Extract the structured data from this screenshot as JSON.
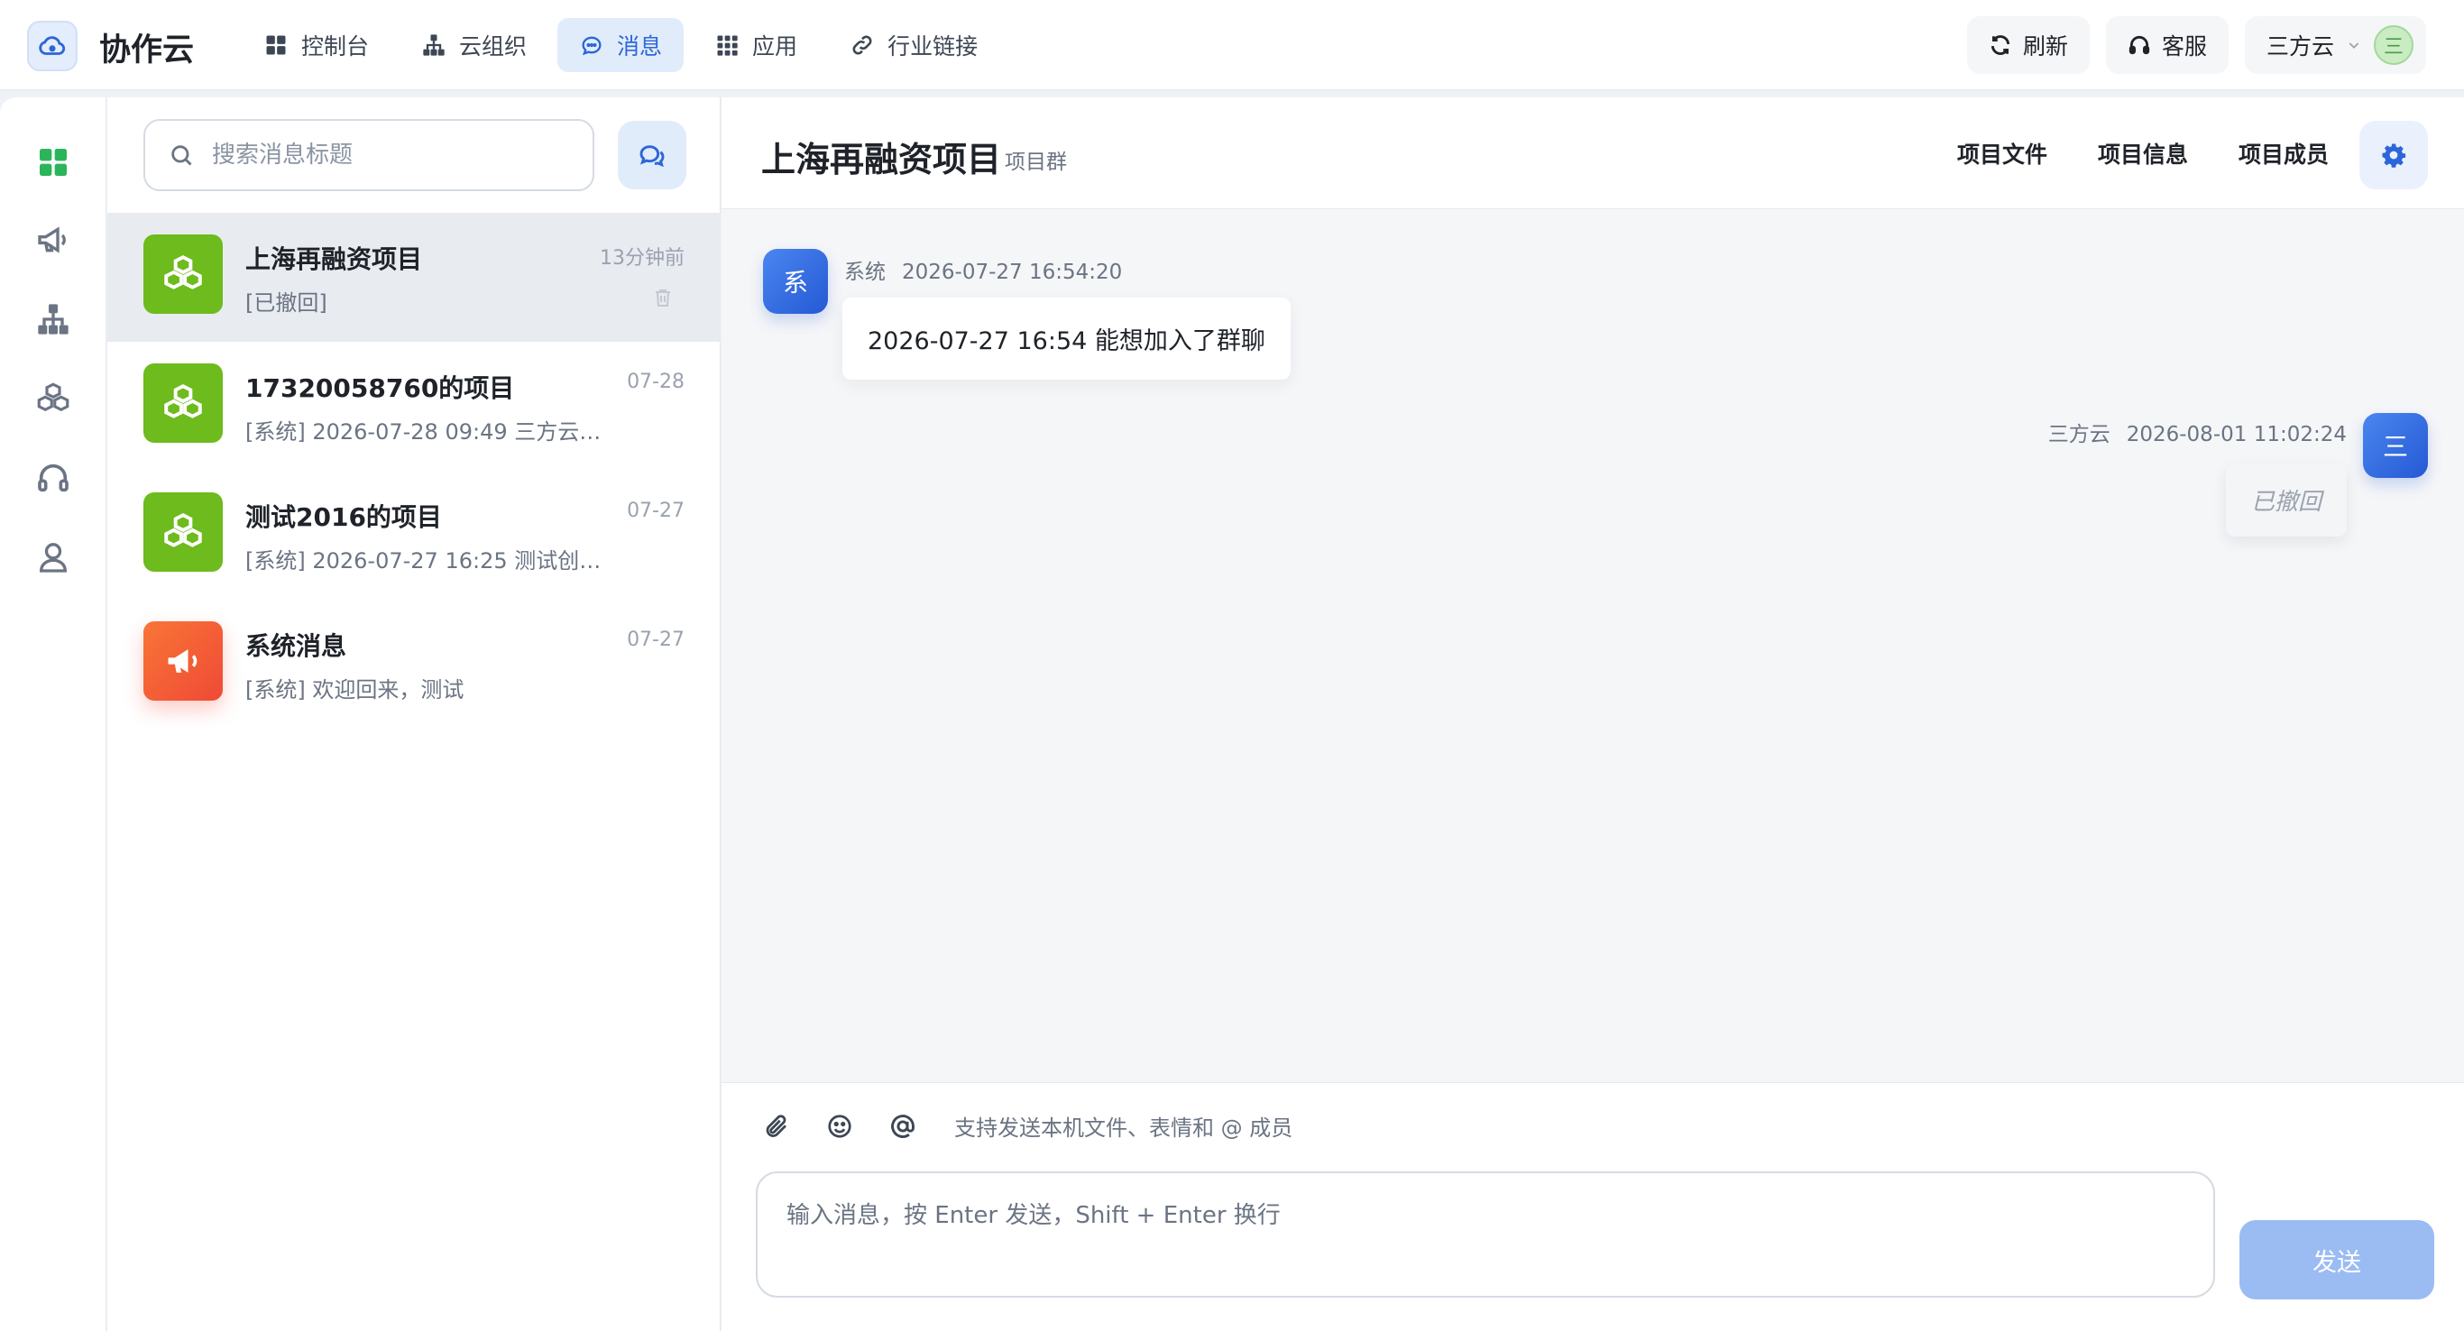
{
  "app": {
    "name": "协作云"
  },
  "nav": [
    {
      "label": "控制台",
      "icon": "grid-icon"
    },
    {
      "label": "云组织",
      "icon": "org-chart-icon"
    },
    {
      "label": "消息",
      "icon": "chat-bubble-icon",
      "active": true
    },
    {
      "label": "应用",
      "icon": "apps-grid-icon"
    },
    {
      "label": "行业链接",
      "icon": "link-icon"
    }
  ],
  "topbar": {
    "refresh_label": "刷新",
    "support_label": "客服",
    "user_name": "三方云",
    "user_avatar_text": "三"
  },
  "rail": [
    "dashboard-icon",
    "megaphone-icon",
    "org-chart-icon",
    "cubes-icon",
    "headset-icon",
    "user-icon"
  ],
  "search": {
    "placeholder": "搜索消息标题",
    "value": ""
  },
  "conversations": [
    {
      "title": "上海再融资项目",
      "preview": "[已撤回]",
      "time": "13分钟前",
      "type": "project",
      "active": true
    },
    {
      "title": "17320058760的项目",
      "preview": "[系统] 2026-07-28 09:49 三方云加入了群聊",
      "time": "07-28",
      "type": "project"
    },
    {
      "title": "测试2016的项目",
      "preview": "[系统] 2026-07-27 16:25 测试创建了项目群",
      "time": "07-27",
      "type": "project"
    },
    {
      "title": "系统消息",
      "preview": "[系统] 欢迎回来，测试",
      "time": "07-27",
      "type": "system"
    }
  ],
  "chat": {
    "title": "上海再融资项目",
    "subtitle": "项目群",
    "header_links": [
      "项目文件",
      "项目信息",
      "项目成员"
    ],
    "messages": [
      {
        "sender": "系统",
        "avatar_text": "系",
        "time": "2026-07-27 16:54:20",
        "text": "2026-07-27 16:54 能想加入了群聊",
        "side": "left"
      },
      {
        "sender": "三方云",
        "avatar_text": "三",
        "time": "2026-08-01 11:02:24",
        "text": "已撤回",
        "side": "right",
        "recalled": true
      }
    ]
  },
  "composer": {
    "hint": "支持发送本机文件、表情和 @ 成员",
    "placeholder": "输入消息，按 Enter 发送，Shift + Enter 换行",
    "send_label": "发送",
    "value": ""
  },
  "colors": {
    "accent": "#2c66d8",
    "active_nav_bg": "#e1ecfb",
    "project_green": "#6dbb1c",
    "system_orange": "#f56a35",
    "send_disabled": "#9bbcf3"
  }
}
